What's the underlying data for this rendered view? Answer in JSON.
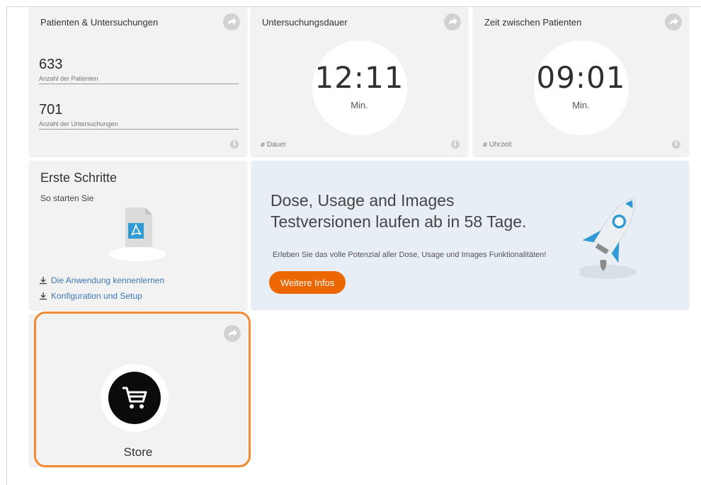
{
  "patients": {
    "title": "Patienten & Untersuchungen",
    "patients_value": "633",
    "patients_label": "Anzahl der Patienten",
    "exams_value": "701",
    "exams_label": "Anzahl der Untersuchungen"
  },
  "duration": {
    "title": "Untersuchungsdauer",
    "time": "12:11",
    "unit": "Min.",
    "footer": "ø Dauer"
  },
  "between": {
    "title": "Zeit zwischen Patienten",
    "time": "09:01",
    "unit": "Min.",
    "footer": "ø Uhrzeit"
  },
  "getting_started": {
    "title": "Erste Schritte",
    "subtitle": "So starten Sie",
    "link1": "Die Anwendung kennenlernen",
    "link2": "Konfiguration und Setup"
  },
  "banner": {
    "title_line1": "Dose, Usage and Images",
    "title_line2": "Testversionen laufen ab in 58 Tage.",
    "text": "Erleben Sie das volle Potenzial aller Dose, Usage und Images Funktionalitäten!",
    "button": "Weitere Infos"
  },
  "store": {
    "label": "Store"
  },
  "colors": {
    "accent": "#ec6602",
    "highlight": "#f28a31",
    "link": "#3d77b6",
    "tile": "#f2f2f2",
    "banner": "#e8eef6"
  },
  "icons": {
    "share": "share-arrow-icon",
    "info": "info-icon",
    "pdf": "pdf-document-icon",
    "download": "download-icon",
    "cart": "shopping-cart-icon",
    "rocket": "rocket-icon"
  }
}
